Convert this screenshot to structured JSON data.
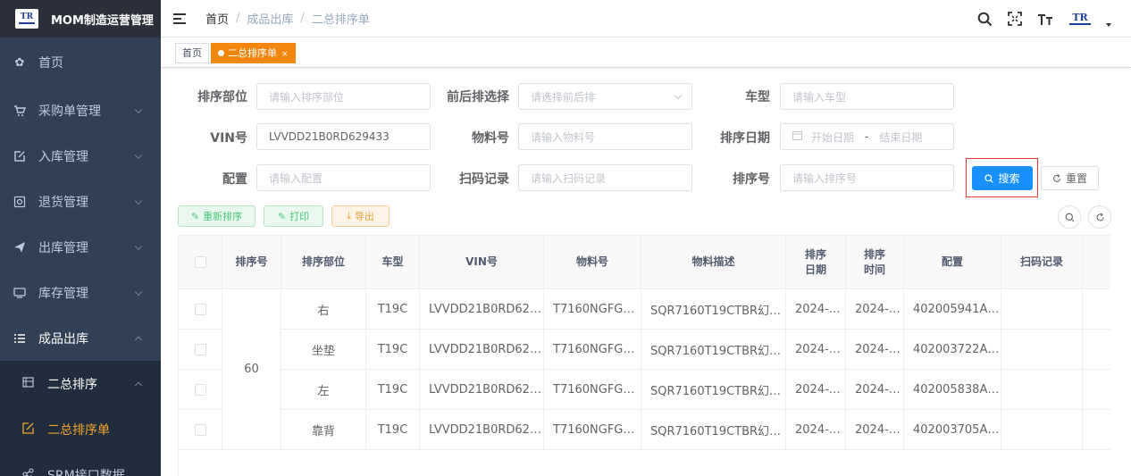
{
  "app": {
    "title": "MOM制造运营管理",
    "logo_text": "TR"
  },
  "sidebar": {
    "items": [
      {
        "label": "首页",
        "icon": "dashboard-icon",
        "glyph": "✿"
      },
      {
        "label": "采购单管理",
        "icon": "cart-icon",
        "glyph": "🛒"
      },
      {
        "label": "入库管理",
        "icon": "edit-icon",
        "glyph": "✎"
      },
      {
        "label": "退货管理",
        "icon": "return-icon",
        "glyph": "▣"
      },
      {
        "label": "出库管理",
        "icon": "send-icon",
        "glyph": "✈"
      },
      {
        "label": "库存管理",
        "icon": "monitor-icon",
        "glyph": "▭"
      },
      {
        "label": "成品出库",
        "icon": "list-icon",
        "glyph": "☰"
      }
    ],
    "sub_group": {
      "label": "二总排序",
      "icon": "table-icon"
    },
    "sub_active": {
      "label": "二总排序单",
      "icon": "form-icon"
    },
    "sub_next": {
      "label": "SRM接口数据",
      "icon": "share-icon"
    }
  },
  "breadcrumb": {
    "home": "首页",
    "level1": "成品出库",
    "level2": "二总排序单"
  },
  "tags": {
    "home": "首页",
    "active": "二总排序单"
  },
  "form": {
    "dept": {
      "label": "排序部位",
      "placeholder": "请输入排序部位"
    },
    "front_back": {
      "label": "前后排选择",
      "placeholder": "请选择前后排"
    },
    "car_type": {
      "label": "车型",
      "placeholder": "请输入车型"
    },
    "vin": {
      "label": "VIN号",
      "value": "LVVDD21B0RD629433"
    },
    "material_no": {
      "label": "物料号",
      "placeholder": "请输入物料号"
    },
    "sort_date": {
      "label": "排序日期",
      "start_placeholder": "开始日期",
      "end_placeholder": "结束日期",
      "separator": "-"
    },
    "config": {
      "label": "配置",
      "placeholder": "请输入配置"
    },
    "scan_record": {
      "label": "扫码记录",
      "placeholder": "请输入扫码记录"
    },
    "sort_no": {
      "label": "排序号",
      "placeholder": "请输入排序号"
    },
    "search_label": "搜索",
    "reset_label": "重置"
  },
  "toolbar": {
    "resort_label": "重新排序",
    "print_label": "打印",
    "export_label": "导出"
  },
  "table": {
    "headers": [
      "排序号",
      "排序部位",
      "车型",
      "VIN号",
      "物料号",
      "物料描述",
      "排序日期",
      "排序时间",
      "配置",
      "扫码记录"
    ],
    "sort_no": "60",
    "rows": [
      {
        "part": "右",
        "car": "T19C",
        "vin": "LVVDD21B0RD62…",
        "material": "T7160NGFG…",
        "desc": "SQR7160T19CTBR幻…",
        "date": "2024-…",
        "time": "2024-…",
        "config": "402005941A…",
        "scan": ""
      },
      {
        "part": "坐垫",
        "car": "T19C",
        "vin": "LVVDD21B0RD62…",
        "material": "T7160NGFG…",
        "desc": "SQR7160T19CTBR幻…",
        "date": "2024-…",
        "time": "2024-…",
        "config": "402003722A…",
        "scan": ""
      },
      {
        "part": "左",
        "car": "T19C",
        "vin": "LVVDD21B0RD62…",
        "material": "T7160NGFG…",
        "desc": "SQR7160T19CTBR幻…",
        "date": "2024-…",
        "time": "2024-…",
        "config": "402005838A…",
        "scan": ""
      },
      {
        "part": "靠背",
        "car": "T19C",
        "vin": "LVVDD21B0RD62…",
        "material": "T7160NGFG…",
        "desc": "SQR7160T19CTBR幻…",
        "date": "2024-…",
        "time": "2024-…",
        "config": "402003705A…",
        "scan": ""
      }
    ]
  },
  "colors": {
    "sidebar_bg": "#304156",
    "accent_orange": "#f2870f",
    "primary_blue": "#1890ff",
    "highlight_red": "#e53b2c"
  }
}
